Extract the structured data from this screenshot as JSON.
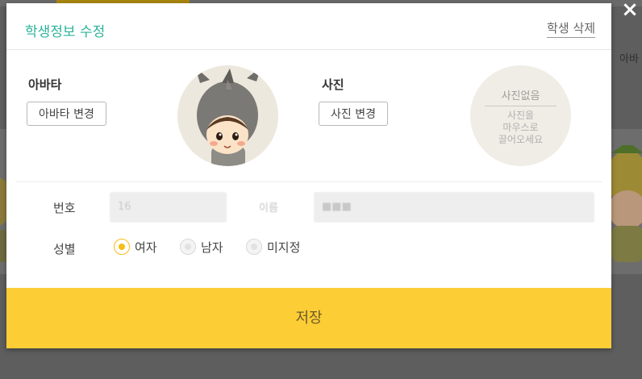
{
  "background": {
    "right_text": "아바"
  },
  "modal": {
    "title": "학생정보 수정",
    "delete_label": "학생 삭제",
    "close_icon": "×",
    "avatar": {
      "label": "아바타",
      "change_button": "아바타 변경"
    },
    "photo": {
      "label": "사진",
      "change_button": "사진 변경",
      "empty_text": "사진없음",
      "hint_lines": [
        "사진을",
        "마우스로",
        "끌어오세요"
      ]
    },
    "number": {
      "label": "번호",
      "value": "16",
      "name_label": "이름",
      "name_value": "■■■"
    },
    "gender": {
      "label": "성별",
      "options": [
        {
          "label": "여자",
          "checked": true
        },
        {
          "label": "남자",
          "checked": false
        },
        {
          "label": "미지정",
          "checked": false
        }
      ]
    },
    "save_label": "저장"
  },
  "colors": {
    "title": "#2bb39a",
    "save_bar": "#fdcd36",
    "radio_checked": "#f6bd16"
  }
}
